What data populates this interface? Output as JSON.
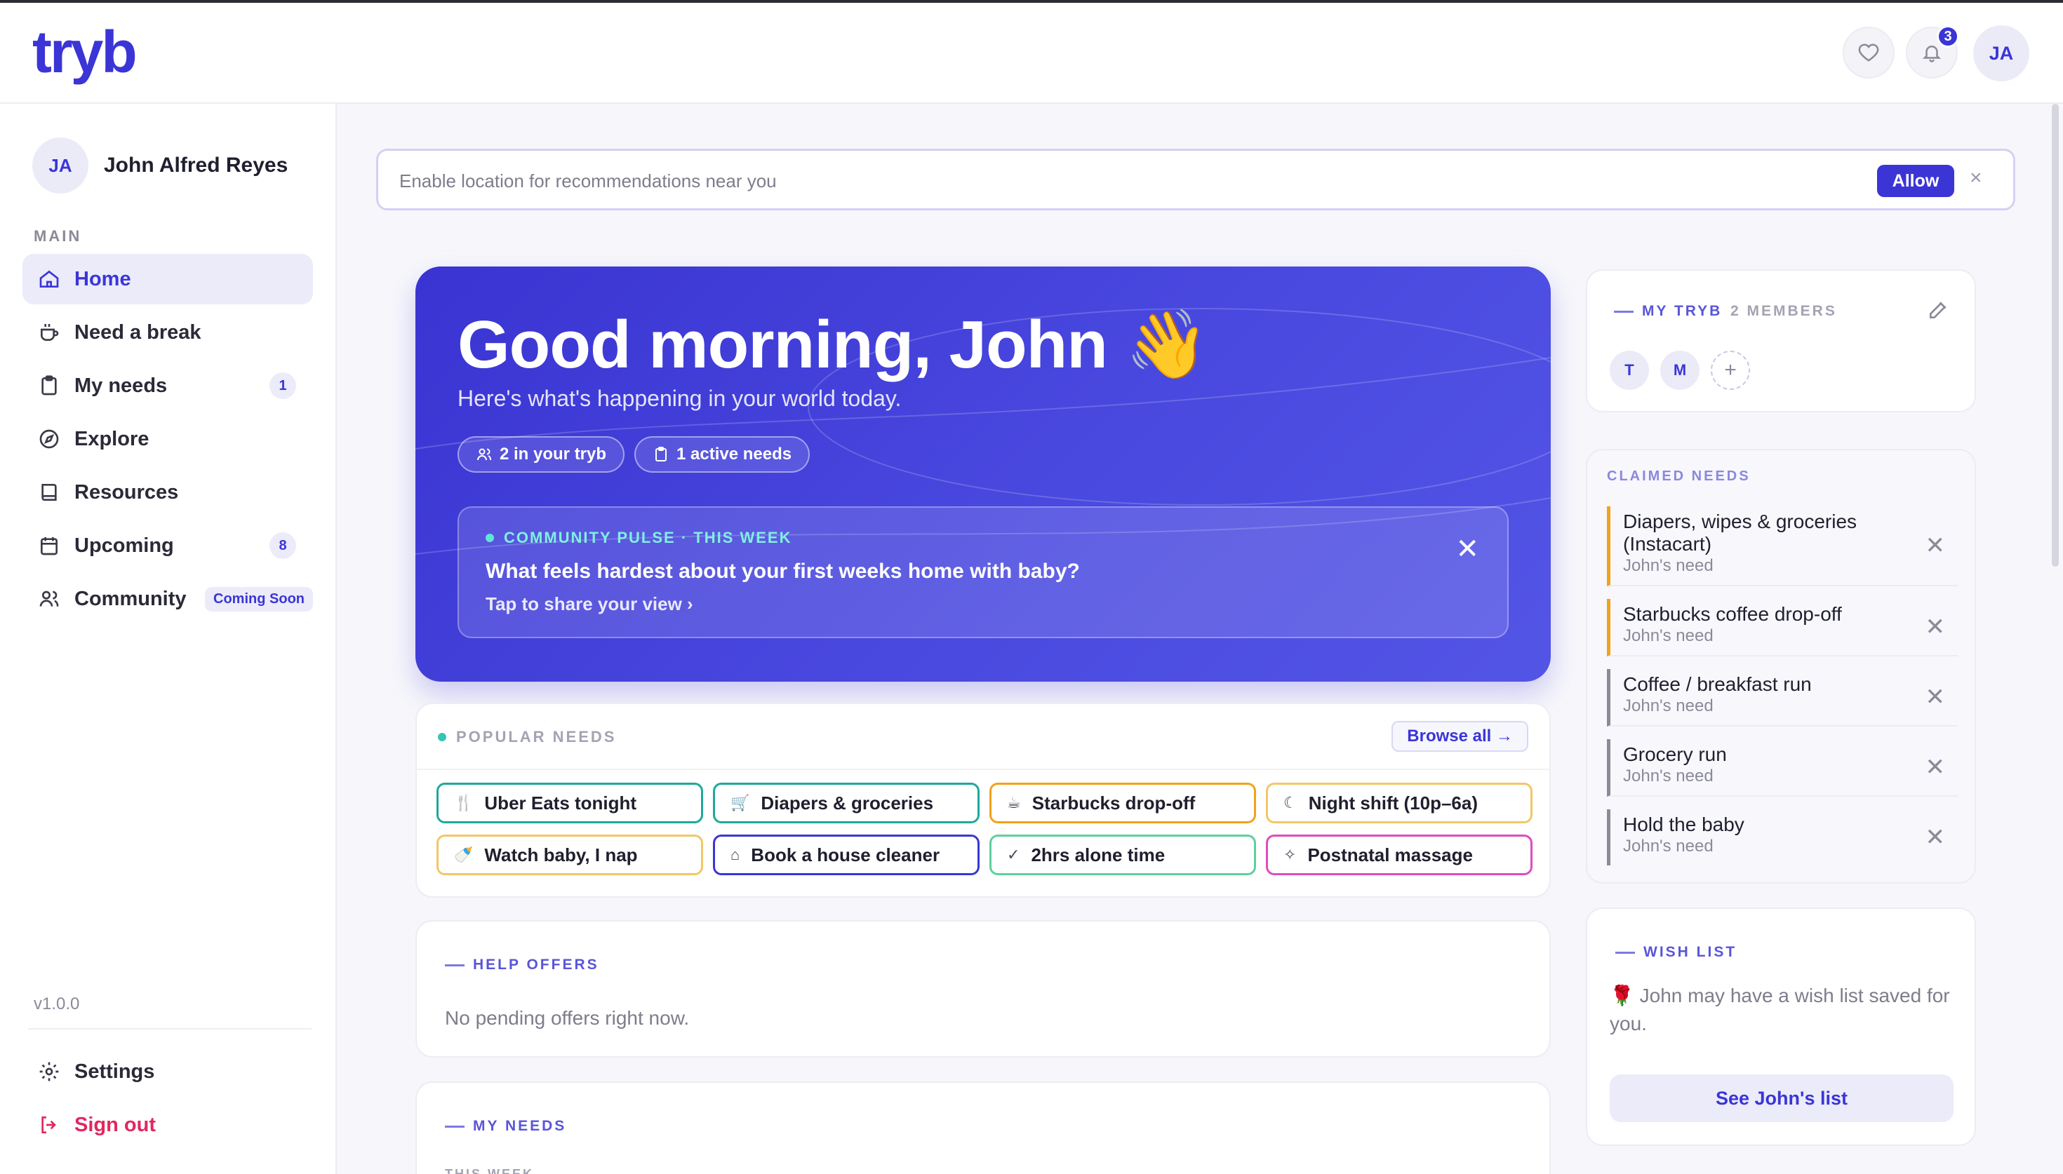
{
  "app": {
    "logo": "tryb"
  },
  "header": {
    "notifications_count": "3",
    "avatar_initials": "JA"
  },
  "sidebar": {
    "user": {
      "initials": "JA",
      "name": "John Alfred Reyes"
    },
    "section_label": "MAIN",
    "items": [
      {
        "label": "Home",
        "icon": "home-icon",
        "active": true
      },
      {
        "label": "Need a break",
        "icon": "coffee-icon"
      },
      {
        "label": "My needs",
        "icon": "clipboard-icon",
        "count": "1"
      },
      {
        "label": "Explore",
        "icon": "compass-icon"
      },
      {
        "label": "Resources",
        "icon": "book-icon"
      },
      {
        "label": "Upcoming",
        "icon": "calendar-icon",
        "count": "8"
      },
      {
        "label": "Community",
        "icon": "users-icon",
        "tag": "Coming Soon"
      }
    ],
    "version": "v1.0.0",
    "settings_label": "Settings",
    "signout_label": "Sign out"
  },
  "location_banner": {
    "text": "Enable location for recommendations near you",
    "allow_label": "Allow",
    "close": "×"
  },
  "hero": {
    "greeting": "Good morning, John 👋",
    "subtitle": "Here's what's happening in your world today.",
    "chip_tryb": "2 in your tryb",
    "chip_needs": "1 active needs",
    "pulse": {
      "tag": "COMMUNITY PULSE · THIS WEEK",
      "question": "What feels hardest about your first weeks home with baby?",
      "link": "Tap to share your view ›"
    }
  },
  "popular_needs": {
    "label": "POPULAR NEEDS",
    "browse_label": "Browse all →",
    "items": [
      {
        "label": "Uber Eats tonight",
        "icon": "🍴",
        "color": "#1fa89a"
      },
      {
        "label": "Diapers & groceries",
        "icon": "🛒",
        "color": "#1fa89a"
      },
      {
        "label": "Starbucks drop-off",
        "icon": "☕",
        "color": "#f2a21b"
      },
      {
        "label": "Night shift (10p–6a)",
        "icon": "☾",
        "color": "#f2c766"
      },
      {
        "label": "Watch baby, I nap",
        "icon": "🍼",
        "color": "#f2c766"
      },
      {
        "label": "Book a house cleaner",
        "icon": "⌂",
        "color": "#3b35d6"
      },
      {
        "label": "2hrs alone time",
        "icon": "✓",
        "color": "#5fcf9e"
      },
      {
        "label": "Postnatal massage",
        "icon": "✧",
        "color": "#e04bbf"
      }
    ]
  },
  "help_offers": {
    "label": "HELP OFFERS",
    "empty_text": "No pending offers right now."
  },
  "my_needs": {
    "label": "MY NEEDS",
    "sub_label": "THIS WEEK"
  },
  "my_tryb": {
    "label": "MY TRYB",
    "members_count": "2 MEMBERS",
    "members": [
      "T",
      "M"
    ],
    "add": "+"
  },
  "claimed_needs": {
    "label": "CLAIMED NEEDS",
    "items": [
      {
        "title": "Diapers, wipes & groceries (Instacart)",
        "sub": "John's need",
        "color": "#f2a21b"
      },
      {
        "title": "Starbucks coffee drop-off",
        "sub": "John's need",
        "color": "#f2a21b"
      },
      {
        "title": "Coffee / breakfast run",
        "sub": "John's need",
        "color": "#8a8a99"
      },
      {
        "title": "Grocery run",
        "sub": "John's need",
        "color": "#8a8a99"
      },
      {
        "title": "Hold the baby",
        "sub": "John's need",
        "color": "#8a8a99"
      }
    ]
  },
  "wish_list": {
    "label": "WISH LIST",
    "text": "🌹 John may have a wish list saved for you.",
    "button_label": "See John's list"
  }
}
